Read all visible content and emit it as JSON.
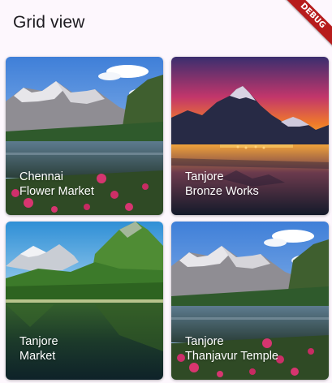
{
  "app_bar": {
    "title": "Grid view",
    "debug_banner": "DEBUG"
  },
  "grid": {
    "tiles": [
      {
        "line1": "Chennai",
        "line2": "Flower Market",
        "scene": "mountain-lake-flowers"
      },
      {
        "line1": "Tanjore",
        "line2": "Bronze Works",
        "scene": "sunset-mountain-lake"
      },
      {
        "line1": "Tanjore",
        "line2": "Market",
        "scene": "green-mountain-lake"
      },
      {
        "line1": "Tanjore",
        "line2": "Thanjavur Temple",
        "scene": "mountain-lake-flowers"
      }
    ]
  },
  "colors": {
    "background": "#fdf7fd",
    "title_text": "#1d1b20",
    "debug_banner": "#b71c1c",
    "caption_text": "#ffffff"
  }
}
